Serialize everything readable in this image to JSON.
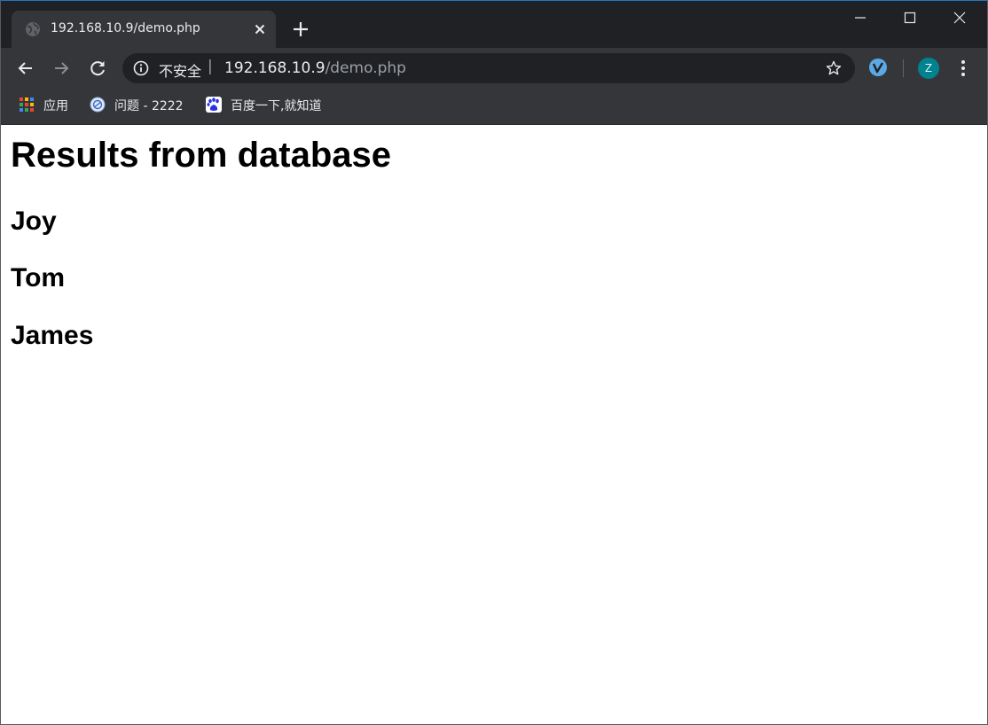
{
  "browser": {
    "tab": {
      "title": "192.168.10.9/demo.php",
      "favicon": "globe-icon"
    },
    "window_controls": [
      "minimize-icon",
      "maximize-icon",
      "close-icon"
    ],
    "toolbar": {
      "back": "arrow-left-icon",
      "forward": "arrow-right-icon",
      "reload": "reload-icon",
      "address": {
        "security_label": "不安全",
        "separator": "|",
        "host": "192.168.10.9",
        "path": "/demo.php"
      },
      "profile_initial": "Z"
    },
    "bookmarks": [
      {
        "label": "应用",
        "icon": "apps-grid-icon"
      },
      {
        "label": "问题 - 2222",
        "icon": "bookmark-globe-icon"
      },
      {
        "label": "百度一下,就知道",
        "icon": "baidu-paw-icon"
      }
    ]
  },
  "page": {
    "heading": "Results from database",
    "results": [
      "Joy",
      "Tom",
      "James"
    ]
  },
  "colors": {
    "tabstrip_bg": "#202124",
    "toolbar_bg": "#35363a",
    "omnibox_bg": "#202124",
    "avatar_bg": "#00838f",
    "page_bg": "#ffffff"
  }
}
